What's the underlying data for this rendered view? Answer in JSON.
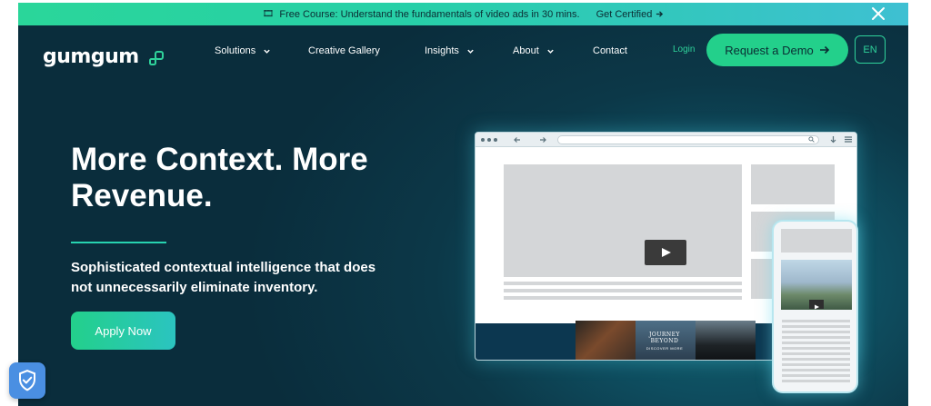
{
  "announcement": {
    "icon": "film-icon",
    "text": "Free Course: Understand the fundamentals of video ads in 30 mins.",
    "cta": "Get Certified"
  },
  "brand": {
    "name": "gumgum",
    "colors": {
      "accent": "#23d08b",
      "dark": "#0a2d3c",
      "teal": "#136874"
    }
  },
  "nav": {
    "items": [
      {
        "label": "Solutions",
        "has_dropdown": true
      },
      {
        "label": "Creative Gallery",
        "has_dropdown": false
      },
      {
        "label": "Insights",
        "has_dropdown": true
      },
      {
        "label": "About",
        "has_dropdown": true
      },
      {
        "label": "Contact",
        "has_dropdown": false
      }
    ],
    "login": "Login",
    "demo": "Request a Demo",
    "language": "EN"
  },
  "hero": {
    "headline": "More Context. More Revenue.",
    "subhead": "Sophisticated contextual intelligence that does not unnecessarily eliminate inventory.",
    "cta": "Apply Now"
  },
  "mockup": {
    "ad_title": "JOURNEY BEYOND",
    "ad_cta": "DISCOVER MORE"
  }
}
